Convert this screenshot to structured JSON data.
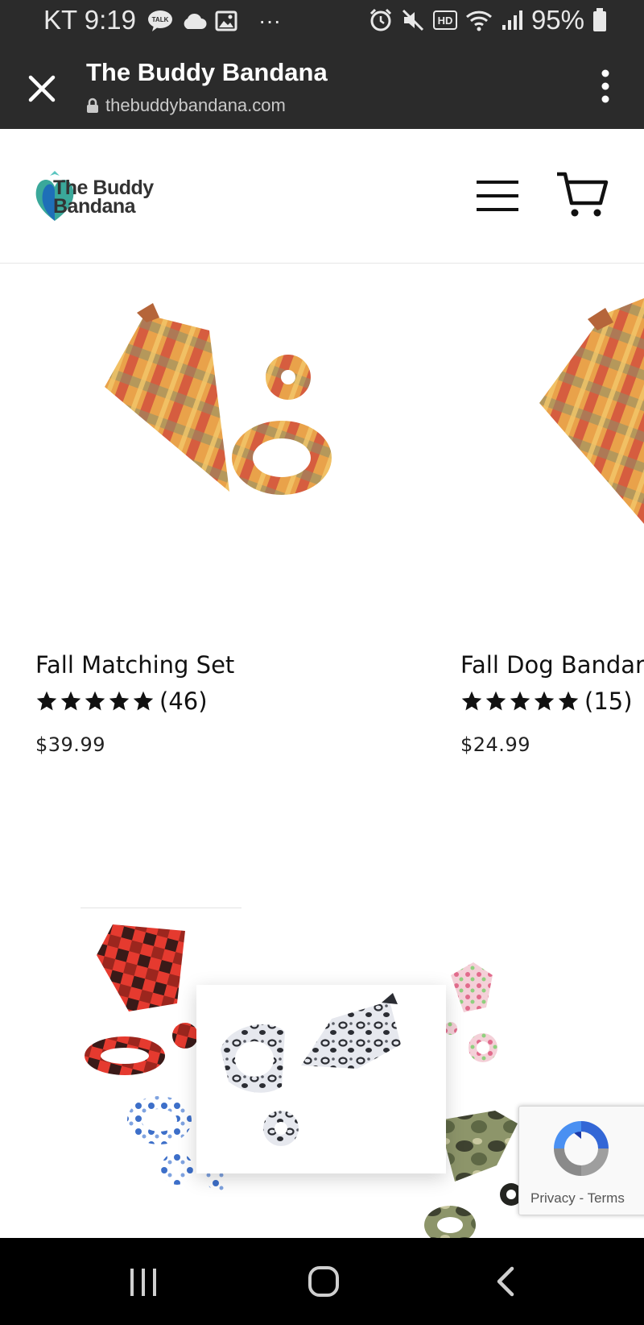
{
  "status_bar": {
    "carrier_time": "KT 9:19",
    "more": "···",
    "battery": "95%",
    "icons": [
      "talk-icon",
      "cloud-icon",
      "gallery-icon",
      "alarm-icon",
      "mute-icon",
      "hd-icon",
      "wifi-icon",
      "signal-icon",
      "battery-icon"
    ]
  },
  "browser": {
    "title": "The Buddy Bandana",
    "url": "thebuddybandana.com",
    "icons": [
      "close-icon",
      "lock-icon",
      "more-vert-icon"
    ]
  },
  "site": {
    "logo_line1": "The Buddy",
    "logo_line2": "Bandana",
    "icons": [
      "menu-icon",
      "cart-icon"
    ]
  },
  "products": [
    {
      "name": "Fall Matching Set",
      "rating_stars": 5,
      "reviews": "(46)",
      "price": "$39.99"
    },
    {
      "name": "Fall Dog Bandar",
      "rating_stars": 5,
      "reviews": "(15)",
      "price": "$24.99"
    }
  ],
  "recaptcha": {
    "privacy": "Privacy",
    "sep": "-",
    "terms": "Terms"
  },
  "colors": {
    "chrome_dark": "#2b2b2b",
    "plaid_orange": "#d8873f",
    "plaid_red": "#d0453a",
    "buffalo_red": "#e53a2f",
    "leopard_gray": "#cfd4dc",
    "camo_green": "#6f7a4e"
  }
}
